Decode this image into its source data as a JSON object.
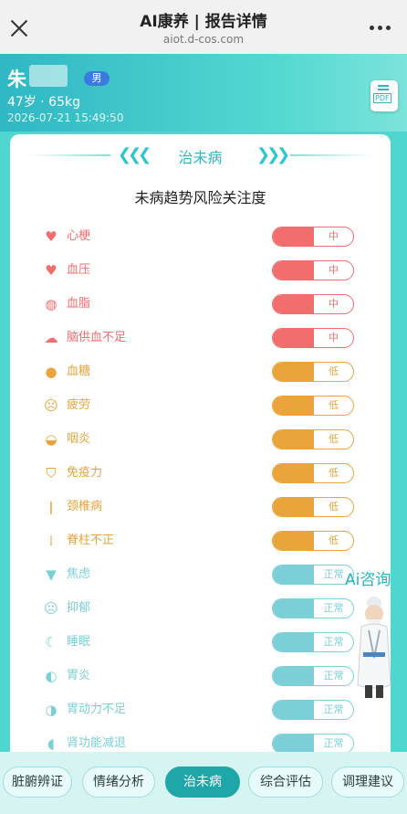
{
  "browser": {
    "title": "AI康养 | 报告详情",
    "url": "aiot.d-cos.com",
    "close_icon": "close-icon",
    "more_icon": "more-icon"
  },
  "user": {
    "name": "朱",
    "gender": "男",
    "age_weight": "47岁 · 65kg",
    "datetime": "2026-07-21 15:49:50",
    "pdf_label": "PDF"
  },
  "section": {
    "title": "治未病",
    "subtitle": "未病趋势风险关注度"
  },
  "colors": {
    "high": "#f26e6e",
    "low": "#e9a43b",
    "normal": "#7ccfd6"
  },
  "risks": [
    {
      "name": "心梗",
      "level": "中",
      "status": "high",
      "icon": "heart-person-icon"
    },
    {
      "name": "血压",
      "level": "中",
      "status": "high",
      "icon": "heartbeat-icon"
    },
    {
      "name": "血脂",
      "level": "中",
      "status": "high",
      "icon": "lipid-icon"
    },
    {
      "name": "脑供血不足",
      "level": "中",
      "status": "high",
      "icon": "brain-icon"
    },
    {
      "name": "血糖",
      "level": "低",
      "status": "low",
      "icon": "drop-icon"
    },
    {
      "name": "疲劳",
      "level": "低",
      "status": "low",
      "icon": "tired-face-icon"
    },
    {
      "name": "咽炎",
      "level": "低",
      "status": "low",
      "icon": "throat-icon"
    },
    {
      "name": "免疫力",
      "level": "低",
      "status": "low",
      "icon": "shield-icon"
    },
    {
      "name": "颈椎病",
      "level": "低",
      "status": "low",
      "icon": "neck-icon"
    },
    {
      "name": "脊柱不正",
      "level": "低",
      "status": "low",
      "icon": "spine-icon"
    },
    {
      "name": "焦虑",
      "level": "正常",
      "status": "normal",
      "icon": "shirt-icon"
    },
    {
      "name": "抑郁",
      "level": "正常",
      "status": "normal",
      "icon": "sad-face-icon"
    },
    {
      "name": "睡眠",
      "level": "正常",
      "status": "normal",
      "icon": "sleep-icon"
    },
    {
      "name": "胃炎",
      "level": "正常",
      "status": "normal",
      "icon": "stomach-icon"
    },
    {
      "name": "胃动力不足",
      "level": "正常",
      "status": "normal",
      "icon": "stomach-motion-icon"
    },
    {
      "name": "肾功能减退",
      "level": "正常",
      "status": "normal",
      "icon": "kidney-icon"
    }
  ],
  "assistant": {
    "label": "Ai咨询"
  },
  "tabs": [
    {
      "label": "脏腑辨证",
      "active": false
    },
    {
      "label": "情绪分析",
      "active": false
    },
    {
      "label": "治未病",
      "active": true
    },
    {
      "label": "综合评估",
      "active": false
    },
    {
      "label": "调理建议",
      "active": false
    }
  ]
}
